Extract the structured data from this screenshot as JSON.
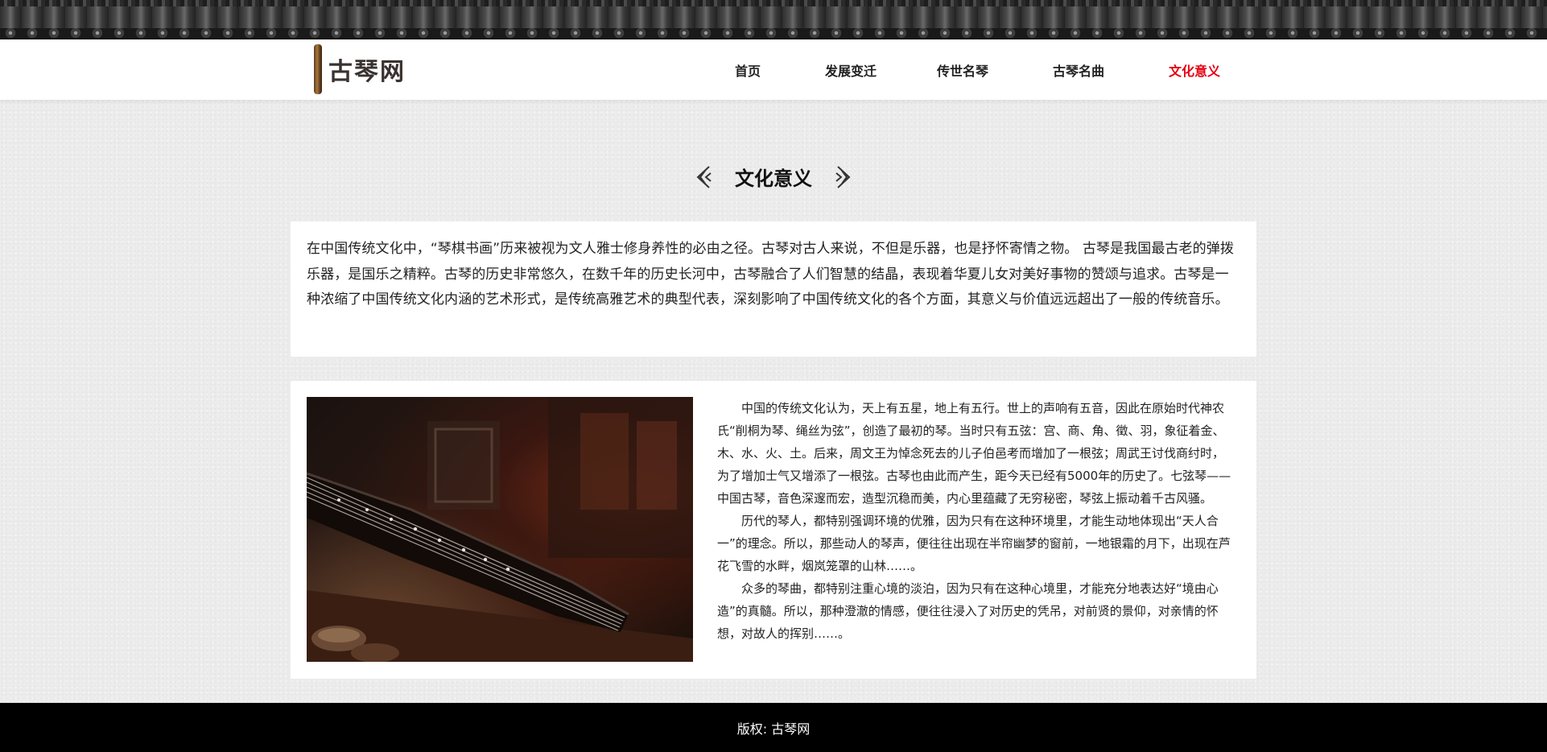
{
  "site": {
    "logo_text": "古琴网"
  },
  "nav": {
    "items": [
      {
        "label": "首页"
      },
      {
        "label": "发展变迁"
      },
      {
        "label": "传世名琴"
      },
      {
        "label": "古琴名曲"
      },
      {
        "label": "文化意义"
      }
    ],
    "active": "文化意义",
    "active_color": "#e60012"
  },
  "section": {
    "title": "文化意义"
  },
  "intro": {
    "text": "在中国传统文化中，“琴棋书画”历来被视为文人雅士修身养性的必由之径。古琴对古人来说，不但是乐器，也是抒怀寄情之物。 古琴是我国最古老的弹拨乐器，是国乐之精粹。古琴的历史非常悠久，在数千年的历史长河中，古琴融合了人们智慧的结晶，表现着华夏儿女对美好事物的赞颂与追求。古琴是一种浓缩了中国传统文化内涵的艺术形式，是传统高雅艺术的典型代表，深刻影响了中国传统文化的各个方面，其意义与价值远远超出了一般的传统音乐。"
  },
  "detail": {
    "image_icon": "guqin-photo",
    "paragraphs": [
      "中国的传统文化认为，天上有五星，地上有五行。世上的声响有五音，因此在原始时代神农氏“削桐为琴、绳丝为弦”，创造了最初的琴。当时只有五弦：宫、商、角、徵、羽，象征着金、木、水、火、土。后来，周文王为悼念死去的儿子伯邑考而增加了一根弦；周武王讨伐商纣时，为了增加士气又增添了一根弦。古琴也由此而产生，距今天已经有5000年的历史了。七弦琴——中国古琴，音色深邃而宏，造型沉稳而美，内心里蕴藏了无穷秘密，琴弦上振动着千古风骚。",
      "历代的琴人，都特别强调环境的优雅，因为只有在这种环境里，才能生动地体现出“天人合一”的理念。所以，那些动人的琴声，便往往出现在半帘幽梦的窗前，一地银霜的月下，出现在芦花飞雪的水畔，烟岚笼罩的山林……。",
      "众多的琴曲，都特别注重心境的淡泊，因为只有在这种心境里，才能充分地表达好“境由心造”的真髓。所以，那种澄澈的情感，便往往浸入了对历史的凭吊，对前贤的景仰，对亲情的怀想，对故人的挥别……。"
    ]
  },
  "footer": {
    "text": "版权: 古琴网"
  }
}
